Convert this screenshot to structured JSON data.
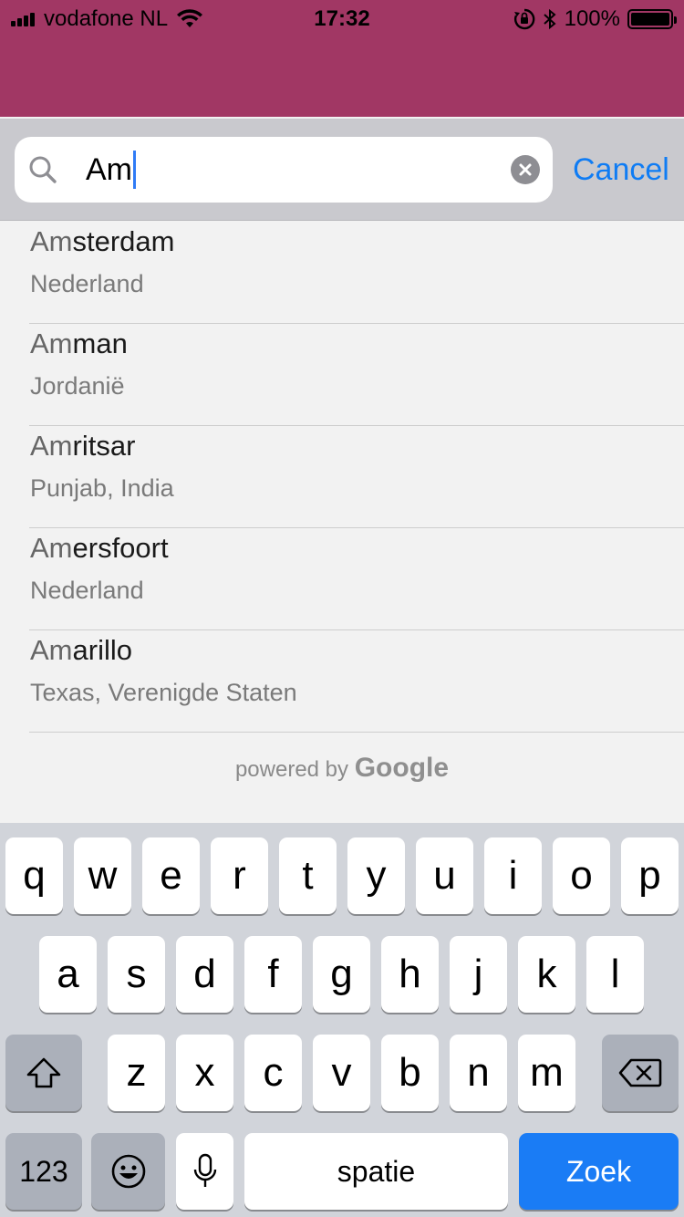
{
  "status_bar": {
    "carrier": "vodafone NL",
    "time": "17:32",
    "battery": "100%",
    "icons": [
      "signal-icon",
      "wifi-icon",
      "orientation-lock-icon",
      "bluetooth-icon",
      "battery-icon"
    ]
  },
  "theme": {
    "nav_color": "#a13764",
    "accent": "#0f7cf4",
    "keyboard_action": "#1a7cf5"
  },
  "search": {
    "query": "Am",
    "cancel_label": "Cancel"
  },
  "results": [
    {
      "match": "Am",
      "rest": "sterdam",
      "subtitle": "Nederland"
    },
    {
      "match": "Am",
      "rest": "man",
      "subtitle": "Jordanië"
    },
    {
      "match": "Am",
      "rest": "ritsar",
      "subtitle": "Punjab, India"
    },
    {
      "match": "Am",
      "rest": "ersfoort",
      "subtitle": "Nederland"
    },
    {
      "match": "Am",
      "rest": "arillo",
      "subtitle": "Texas, Verenigde Staten"
    }
  ],
  "attribution": {
    "prefix": "powered by",
    "brand": "Google"
  },
  "keyboard": {
    "row1": [
      "q",
      "w",
      "e",
      "r",
      "t",
      "y",
      "u",
      "i",
      "o",
      "p"
    ],
    "row2": [
      "a",
      "s",
      "d",
      "f",
      "g",
      "h",
      "j",
      "k",
      "l"
    ],
    "row3": [
      "z",
      "x",
      "c",
      "v",
      "b",
      "n",
      "m"
    ],
    "numbers_label": "123",
    "space_label": "spatie",
    "return_label": "Zoek"
  }
}
